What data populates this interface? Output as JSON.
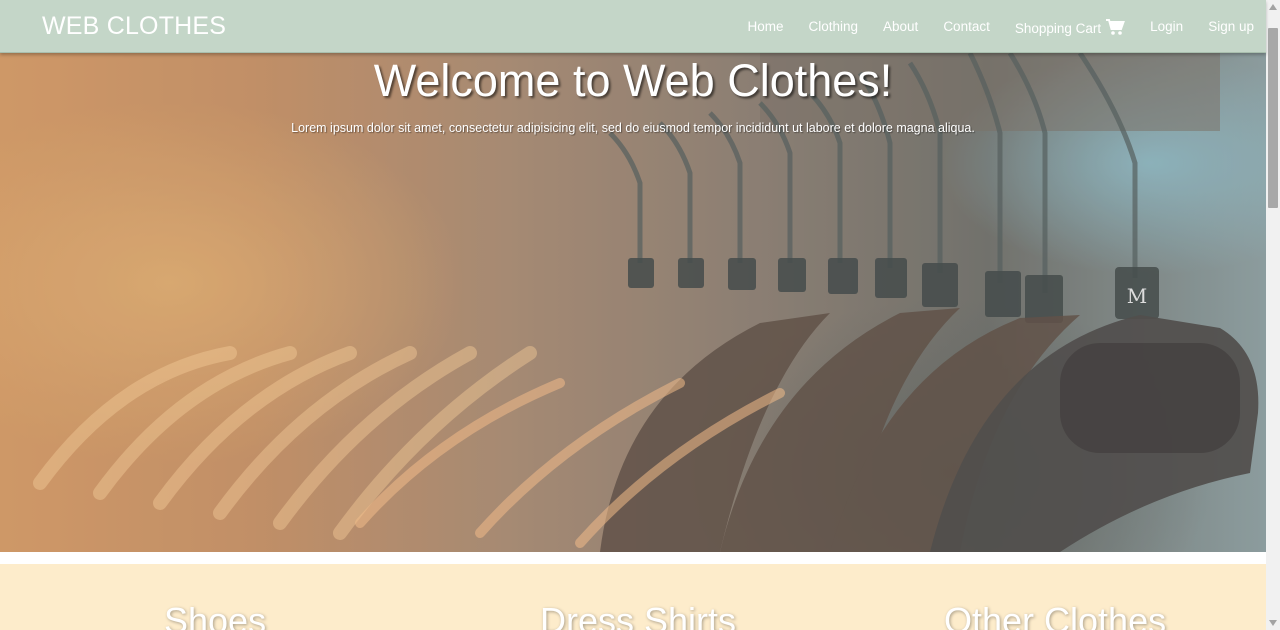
{
  "navbar": {
    "brand": "WEB CLOTHES",
    "links": [
      {
        "label": "Home"
      },
      {
        "label": "Clothing"
      },
      {
        "label": "About"
      },
      {
        "label": "Contact"
      },
      {
        "label": "Shopping Cart",
        "icon": "shopping-cart-icon"
      },
      {
        "label": "Login"
      },
      {
        "label": "Sign up"
      }
    ],
    "background_color": "#c4d6c8"
  },
  "hero": {
    "title": "Welcome to Web Clothes!",
    "subtitle": "Lorem ipsum dolor sit amet, consectetur adipisicing elit, sed do eiusmod tempor incididunt ut labore et dolore magna aliqua.",
    "hanger_tag_letter": "M"
  },
  "categories": [
    {
      "label": "Shoes"
    },
    {
      "label": "Dress Shirts"
    },
    {
      "label": "Other Clothes"
    }
  ],
  "category_strip_color": "#fdeccb"
}
